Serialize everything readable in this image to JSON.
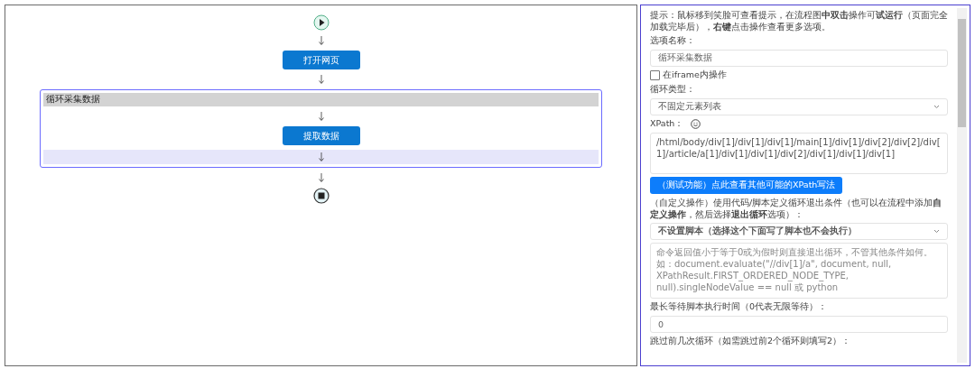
{
  "flow": {
    "start": {
      "kind": "start"
    },
    "steps": [
      {
        "kind": "action",
        "label": "打开网页",
        "selected": false
      },
      {
        "kind": "loop",
        "title": "循环采集数据",
        "selected": true,
        "children": [
          {
            "kind": "action",
            "label": "提取数据",
            "selected": false
          }
        ]
      }
    ],
    "end": {
      "kind": "end"
    }
  },
  "options": {
    "hint": "提示：鼠标移到笑脸可查看提示，在流程图**中双击**操作可**试运行**（页面完全加载完毕后），**右键**点击操作查看更多选项。",
    "name_label": "选项名称：",
    "name_value": "循环采集数据",
    "iframe": {
      "label": "在iframe内操作",
      "checked": false
    },
    "loop_type_label": "循环类型：",
    "loop_type_value": "不固定元素列表",
    "xpath_label": "XPath：",
    "xpath_value": "/html/body/div[1]/div[1]/div[1]/main[1]/div[1]/div[2]/div[2]/div[1]/article/a[1]/div[1]/div[1]/div[2]/div[1]/div[1]/div[1]",
    "xpath_button": "（测试功能）点此查看其他可能的XPath写法",
    "script_desc": "（自定义操作）使用代码/脚本定义循环退出条件（也可以在流程中添加**自定义操作**，然后选择**退出循环**选项）：",
    "script_select": "不设置脚本（选择这个下面写了脚本也不会执行）",
    "script_placeholder": "命令返回值小于等于0或为假时则直接退出循环，不管其他条件如何。如：document.evaluate(\"//div[1]/a\", document, null, XPathResult.FIRST_ORDERED_NODE_TYPE, null).singleNodeValue == null 或 python",
    "wait_label": "最长等待脚本执行时间（0代表无限等待）：",
    "wait_value": "0",
    "skip_label": "跳过前几次循环（如需跳过前2个循环则填写2）："
  }
}
